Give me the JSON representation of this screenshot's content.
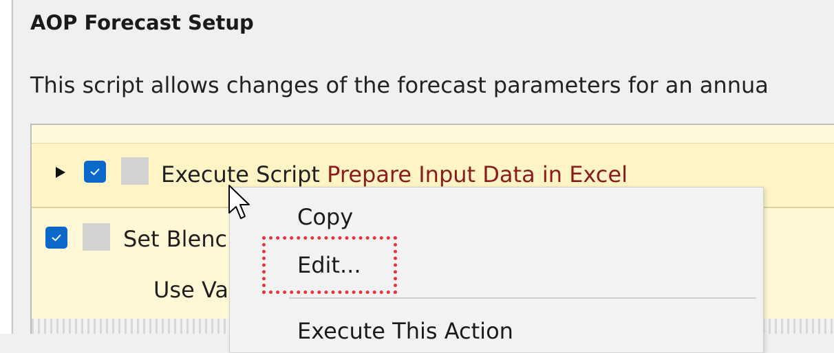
{
  "header": {
    "title": "AOP Forecast Setup",
    "description": "This script allows changes of the forecast parameters for an annua"
  },
  "actions": [
    {
      "expanded": false,
      "checked": true,
      "prefix": "Execute Script",
      "target": "Prepare Input Data in Excel"
    },
    {
      "checked": true,
      "prefix": "Set Blenc",
      "sub_label": "Use Va"
    }
  ],
  "context_menu": {
    "items": [
      {
        "label": "Copy"
      },
      {
        "label": "Edit..."
      },
      {
        "label": "Execute This Action"
      }
    ],
    "highlighted_item": "Edit..."
  },
  "colors": {
    "checkbox": "#0a68c8",
    "link": "#8b1a1a",
    "panel_background": "#fff4c6",
    "highlight_border": "#e8323c"
  }
}
